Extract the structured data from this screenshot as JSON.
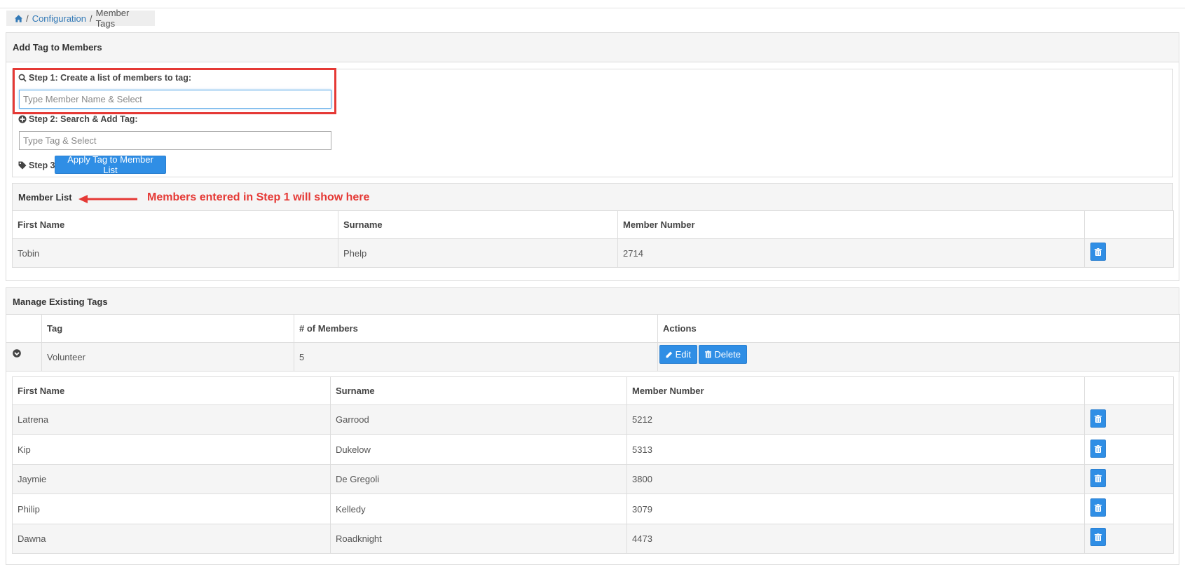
{
  "breadcrumb": {
    "sep1": "/",
    "configuration": "Configuration",
    "sep2": "/",
    "current": "Member Tags"
  },
  "add_panel": {
    "title": "Add Tag to Members",
    "step1_label": "Step 1: Create a list of members to tag:",
    "step1_placeholder": "Type Member Name & Select",
    "step2_label": "Step 2: Search & Add Tag:",
    "step2_placeholder": "Type Tag & Select",
    "step3_label": "Step 3:",
    "apply_button": "Apply Tag to Member List"
  },
  "member_list": {
    "title": "Member List",
    "annotation": "Members entered in Step 1 will show here",
    "columns": [
      "First Name",
      "Surname",
      "Member Number",
      ""
    ],
    "rows": [
      {
        "first": "Tobin",
        "surname": "Phelp",
        "number": "2714"
      }
    ]
  },
  "manage_panel": {
    "title": "Manage Existing Tags",
    "columns": [
      "",
      "Tag",
      "# of Members",
      "Actions"
    ],
    "tags": [
      {
        "tag": "Volunteer",
        "members": "5",
        "edit": "Edit",
        "delete": "Delete"
      }
    ],
    "sub_columns": [
      "First Name",
      "Surname",
      "Member Number",
      ""
    ],
    "sub_rows": [
      {
        "first": "Latrena",
        "surname": "Garrood",
        "number": "5212"
      },
      {
        "first": "Kip",
        "surname": "Dukelow",
        "number": "5313"
      },
      {
        "first": "Jaymie",
        "surname": "De Gregoli",
        "number": "3800"
      },
      {
        "first": "Philip",
        "surname": "Kelledy",
        "number": "3079"
      },
      {
        "first": "Dawna",
        "surname": "Roadknight",
        "number": "4473"
      }
    ]
  },
  "icons": {
    "home": "home-icon",
    "search": "search-icon",
    "plus_circle": "plus-circle-icon",
    "tag": "tag-icon",
    "trash": "trash-icon",
    "pencil": "pencil-icon",
    "chevron": "chevron-down-circle-icon"
  },
  "colors": {
    "accent": "#2f8ee5",
    "link": "#337ab7",
    "annotation": "#e53935"
  }
}
